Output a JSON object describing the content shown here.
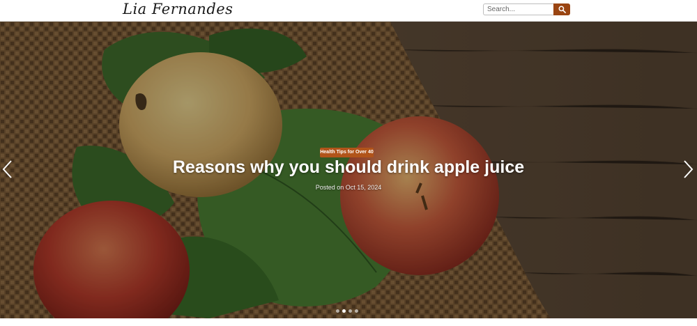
{
  "header": {
    "logo_text": "Lia Fernandes",
    "search": {
      "placeholder": "Search...",
      "button_icon": "search-icon"
    }
  },
  "slider": {
    "category": "Health Tips for Over 40",
    "title": "Reasons why you should drink apple juice",
    "posted": "Posted on Oct 15, 2024",
    "slide_count": 4,
    "active_slide": 2,
    "prev_icon": "chevron-left-icon",
    "next_icon": "chevron-right-icon"
  },
  "colors": {
    "accent": "#b1541a",
    "search_button": "#9a4512",
    "hero_overlay": "#000000"
  }
}
